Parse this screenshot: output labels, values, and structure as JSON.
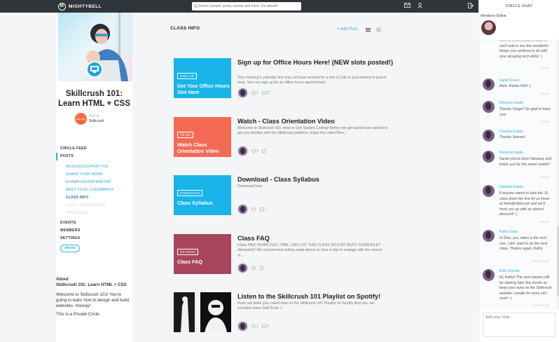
{
  "topbar": {
    "brand": "MIGHTYBELL",
    "search_placeholder": "Search people, posts, events and more. Go ahead!"
  },
  "sidebar": {
    "course_title": "Skillcrush 101: Learn HTML + CSS",
    "posted_in_label": "Part of",
    "org_name": "Skillcrush",
    "org_avatar_text": "skillcrush",
    "nav": [
      {
        "label": "CIRCLE FEED"
      },
      {
        "label": "POSTS"
      }
    ],
    "sub_nav": [
      {
        "label": "RESOURCES/HOW-TOS"
      },
      {
        "label": "SHARE YOUR WORK"
      },
      {
        "label": "EXAMPLES/INSPIRATION"
      },
      {
        "label": "MEET YOUR CLASSMATES"
      },
      {
        "label": "CLASS INFO"
      },
      {
        "label": "1-ON-1 COLLECTIONS"
      },
      {
        "label": "SHOW LESS"
      }
    ],
    "nav2": [
      {
        "label": "EVENTS"
      },
      {
        "label": "MEMBERS"
      },
      {
        "label": "SETTINGS"
      }
    ],
    "invite_label": "INVITE",
    "about": {
      "heading": "About",
      "name": "Skillcrush 101: Learn HTML + CSS",
      "desc": "Welcome to Skillcrush 101! You're going to learn how to design and build websites. Hooray!",
      "privacy": "This is a Private Circle."
    }
  },
  "main": {
    "header": "CLASS INFO",
    "add_post": "+ Add Post",
    "posts": [
      {
        "tag": "SIGN UP",
        "thumb_title": "Get Your Office Hours Slot Here",
        "color": "#18b4ea",
        "title": "Sign up for Office Hours Here! (NEW slots posted!)",
        "body": "This morning's calendar link may not have worked for a few of y'all so just wanted to post it here. You can sign up for an office hours appointment",
        "likes": "1",
        "comments": "27"
      },
      {
        "tag": "TO DO",
        "thumb_title": "Watch Class Orientation Video",
        "color": "#f46b55",
        "title": "Watch - Class Orientation Video",
        "body": "Welcome to Skillcrush 101: How to Get Started Coding! Before we get started we wanted to get you familiar with the Skillcrush platform. Enjoy this video!One...",
        "likes": "4",
        "comments": ""
      },
      {
        "tag": "DOWNLOAD",
        "thumb_title": "Class Syllabus",
        "color": "#18b4ea",
        "title": "Download - Class Syllabus",
        "body": "Download here",
        "likes": "",
        "comments": "1"
      },
      {
        "tag": "READING",
        "thumb_title": "Class FAQ",
        "color": "#a8455a",
        "title": "Class FAQ",
        "body": "Class FAQ! WORK FULL TIME, CAN I FIT THIS CLASS INTO MY BUSY SCHEDULE? Absolutely! We recommend setting aside about an hour a day to engage with the course m...",
        "likes": "",
        "comments": ""
      },
      {
        "tag": "",
        "thumb_title": "",
        "color": "#111111",
        "title": "Listen to the Skillcrush 101 Playlist on Spotify!",
        "body": "Rock out while you code!Listen to the Skillcrush 101 Playlist on Spotify And yes, we included some Daft Punk :)",
        "likes": "1",
        "comments": "4"
      }
    ]
  },
  "chat": {
    "title": "CIRCLE CHAT",
    "members_online": "Members Online",
    "messages": [
      {
        "who": "",
        "text": "were a terrific student, and we can't wait to see the wonderful things you continue to do with your amazing tech skills! :)",
        "time": "Feb 23"
      },
      {
        "who": "Sarah Green",
        "text": "Aww, thanks Kelli :)",
        "time": "Feb 23"
      },
      {
        "who": "Deepina Kapila",
        "text": "Thanks Ginger! So glad to have you!",
        "time": "Feb 23"
      },
      {
        "who": "Deepina Kapila",
        "text": "Thanks Jeanne!",
        "time": ""
      },
      {
        "who": "Deepina Kapila",
        "text": "Sarah you've been fabulous and thank you for the sweet words!!",
        "time": "Feb 23"
      },
      {
        "who": "Deepina Kapila",
        "text": "If anyone wants to take the JS class down the line let us know at hello@skillcrush and we'll hook you up with an alumni discount! :)",
        "time": "Feb 23"
      },
      {
        "who": "Kathy Davis",
        "text": "Hi Dee, yes, when is the next one, I def. want to do the next class. Thanks again, Kathy",
        "time": "12 hours ago"
      },
      {
        "who": "Kelli Gnezda",
        "text": "Hi, Kathy! The next classes will be starting later this month so keep your eyes on the Skillcrush website / emails for more info soon! :)",
        "time": "12 hours ago"
      }
    ],
    "input_placeholder": "Add your chat..."
  }
}
